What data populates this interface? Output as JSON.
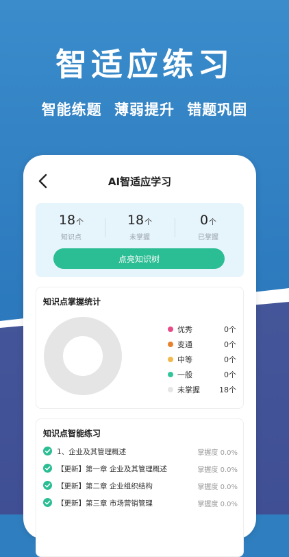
{
  "headline": "智适应练习",
  "subline": "智能练题 薄弱提升 错题巩固",
  "nav": {
    "title": "AI智适应学习"
  },
  "stats": [
    {
      "value": "18",
      "unit": "个",
      "label": "知识点"
    },
    {
      "value": "18",
      "unit": "个",
      "label": "未掌握"
    },
    {
      "value": "0",
      "unit": "个",
      "label": "已掌握"
    }
  ],
  "light_button": "点亮知识树",
  "mastery": {
    "title": "知识点掌握统计",
    "legend": [
      {
        "label": "优秀",
        "value": "0个",
        "color": "#e84a87"
      },
      {
        "label": "变通",
        "value": "0个",
        "color": "#e8812e"
      },
      {
        "label": "中等",
        "value": "0个",
        "color": "#f2b84b"
      },
      {
        "label": "一般",
        "value": "0个",
        "color": "#33c49a"
      },
      {
        "label": "未掌握",
        "value": "18个",
        "color": "#e5e5e5"
      }
    ]
  },
  "practice": {
    "title": "知识点智能练习",
    "rows": [
      {
        "name": "1、企业及其管理概述",
        "rate": "掌握度  0.0%"
      },
      {
        "name": "【更新】第一章 企业及其管理概述",
        "rate": "掌握度  0.0%"
      },
      {
        "name": "【更新】第二章 企业组织结构",
        "rate": "掌握度  0.0%"
      },
      {
        "name": "【更新】第三章 市场营销管理",
        "rate": "掌握度  0.0%"
      }
    ]
  },
  "colors": {
    "accent": "#2bbd93",
    "brand_blue": "#2f7fc0",
    "check": "#2bbd93"
  }
}
